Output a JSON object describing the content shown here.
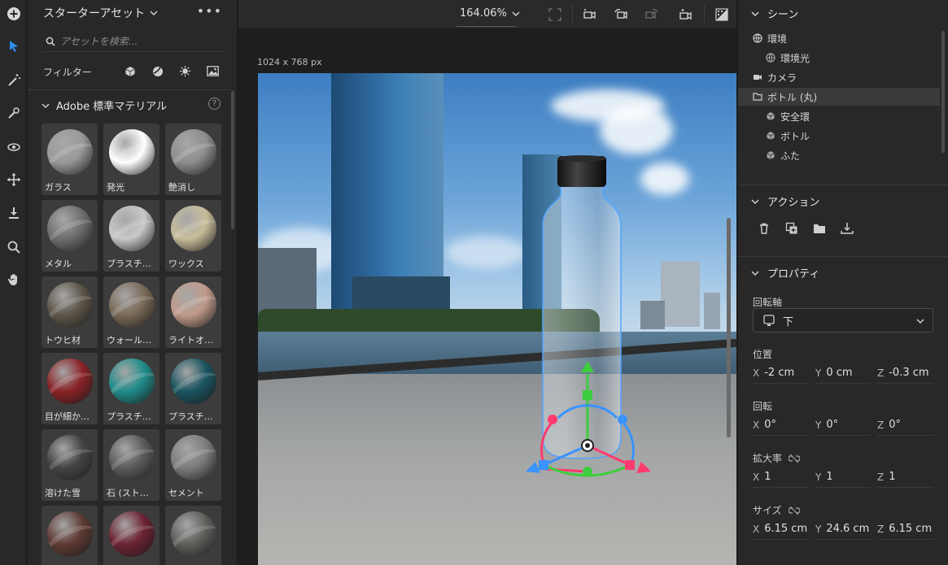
{
  "toolbar": {
    "tools": [
      "add-icon",
      "select-icon",
      "magic-wand-icon",
      "sampler-icon",
      "orbit-icon",
      "move-icon",
      "drop-to-ground-icon",
      "zoom-icon",
      "hand-icon"
    ]
  },
  "assets": {
    "title": "スターターアセット",
    "search_placeholder": "アセットを検索...",
    "filter_label": "フィルター",
    "section_title": "Adobe 標準マテリアル",
    "help": "?",
    "materials": [
      {
        "label": "ガラス",
        "color": "#9a9a9a"
      },
      {
        "label": "発光",
        "color": "#ffffff"
      },
      {
        "label": "艶消し",
        "color": "#8e8e8e"
      },
      {
        "label": "メタル",
        "color": "#6e6e6e"
      },
      {
        "label": "プラスチ…",
        "color": "#c8c8c8"
      },
      {
        "label": "ワックス",
        "color": "#c8bd9a"
      },
      {
        "label": "トウヒ材",
        "color": "#5c5548"
      },
      {
        "label": "ウォール…",
        "color": "#7a6a58"
      },
      {
        "label": "ライトオ…",
        "color": "#c09a8a"
      },
      {
        "label": "目が細か…",
        "color": "#8a2226"
      },
      {
        "label": "プラスチ…",
        "color": "#1f8c8a"
      },
      {
        "label": "プラスチ…",
        "color": "#1a5560"
      },
      {
        "label": "溶けた雪",
        "color": "#444444"
      },
      {
        "label": "石 (スト…",
        "color": "#5a5a5a"
      },
      {
        "label": "セメント",
        "color": "#7c7c7c"
      },
      {
        "label": "",
        "color": "#5e3a33"
      },
      {
        "label": "",
        "color": "#6c2232"
      },
      {
        "label": "",
        "color": "#5c5e5a"
      }
    ]
  },
  "viewport": {
    "zoom": "164.06%",
    "canvas_size": "1024 x 768 px"
  },
  "scene_panel": {
    "title": "シーン",
    "items": [
      {
        "label": "環境",
        "icon": "globe-icon",
        "indent": 0
      },
      {
        "label": "環境光",
        "icon": "globe-icon",
        "indent": 1
      },
      {
        "label": "カメラ",
        "icon": "camera-icon",
        "indent": 0
      },
      {
        "label": "ボトル (丸)",
        "icon": "folder-icon",
        "indent": 0,
        "selected": true
      },
      {
        "label": "安全環",
        "icon": "cube-icon",
        "indent": 1
      },
      {
        "label": "ボトル",
        "icon": "cube-icon",
        "indent": 1
      },
      {
        "label": "ふた",
        "icon": "cube-icon",
        "indent": 1
      }
    ]
  },
  "actions_panel": {
    "title": "アクション"
  },
  "properties": {
    "title": "プロパティ",
    "rotation_axis_label": "回転軸",
    "rotation_axis_value": "下",
    "position_label": "位置",
    "position": {
      "x": "-2 cm",
      "y": "0 cm",
      "z": "-0.3 cm"
    },
    "rotation_label": "回転",
    "rotation": {
      "x": "0°",
      "y": "0°",
      "z": "0°"
    },
    "scale_label": "拡大率",
    "scale": {
      "x": "1",
      "y": "1",
      "z": "1"
    },
    "size_label": "サイズ",
    "size": {
      "x": "6.15 cm",
      "y": "24.6 cm",
      "z": "6.15 cm"
    },
    "axis_x": "X",
    "axis_y": "Y",
    "axis_z": "Z"
  },
  "colors": {
    "accent": "#2d8ceb",
    "gizmo_x": "#ff3b6f",
    "gizmo_y": "#3dcd3d",
    "gizmo_z": "#3a93ff"
  }
}
